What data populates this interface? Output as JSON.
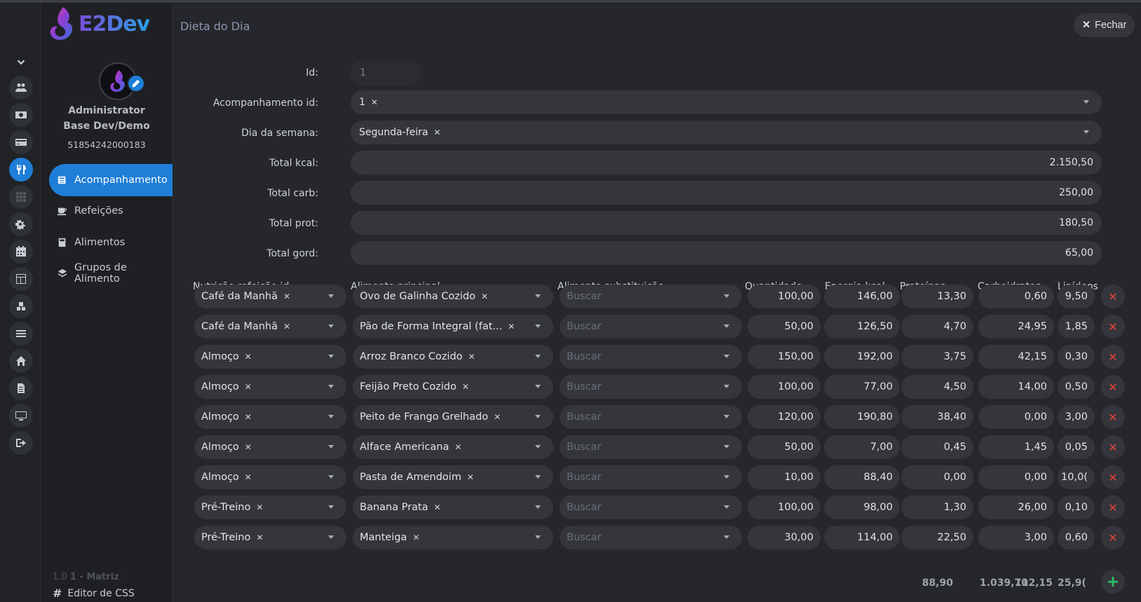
{
  "app": {
    "name": "E2Dev"
  },
  "user": {
    "name": "Administrator",
    "company": "Base Dev/Demo",
    "document": "51854242000183"
  },
  "nav": {
    "items": [
      {
        "label": "Acompanhamento",
        "icon": "newspaper-icon",
        "active": true
      },
      {
        "label": "Refeições",
        "icon": "coffee-cup-icon"
      },
      {
        "label": "Alimentos",
        "icon": "book-icon"
      },
      {
        "label": "Grupos de Alimento",
        "icon": "layers-icon"
      }
    ],
    "version": "1.0",
    "version_extra": "1 - Matriz",
    "css_editor": "Editor de CSS"
  },
  "rail_icons": [
    "users-icon",
    "money-icon",
    "credit-card-icon",
    "utensils-icon",
    "grid-icon",
    "cogs-icon",
    "calendar-icon",
    "layout-icon",
    "boxes-icon",
    "list-icon",
    "home-icon",
    "file-icon",
    "desktop-icon",
    "logout-icon"
  ],
  "page": {
    "title": "Dieta do Dia",
    "close_label": "Fechar"
  },
  "form": {
    "id_label": "Id:",
    "id_value": "1",
    "acomp_label": "Acompanhamento id:",
    "acomp_value": "1",
    "dia_label": "Dia da semana:",
    "dia_value": "Segunda-feira",
    "kcal_label": "Total kcal:",
    "kcal_value": "2.150,50",
    "carb_label": "Total carb:",
    "carb_value": "250,00",
    "prot_label": "Total prot:",
    "prot_value": "180,50",
    "gord_label": "Total gord:",
    "gord_value": "65,00"
  },
  "table": {
    "headers": [
      "Nutrição refeição id",
      "Alimento principal",
      "Alimento substituição",
      "Quantidade",
      "Energia kcal",
      "Proteínas",
      "Carboidratos",
      "Lipídeos"
    ],
    "placeholder": "Buscar",
    "rows": [
      {
        "refeicao": "Café da Manhã",
        "alimento": "Ovo de Galinha Cozido",
        "qtd": "100,00",
        "kcal": "146,00",
        "prot": "13,30",
        "carb": "0,60",
        "lip": "9,50"
      },
      {
        "refeicao": "Café da Manhã",
        "alimento": "Pão de Forma Integral (fat...",
        "qtd": "50,00",
        "kcal": "126,50",
        "prot": "4,70",
        "carb": "24,95",
        "lip": "1,85"
      },
      {
        "refeicao": "Almoço",
        "alimento": "Arroz Branco Cozido",
        "qtd": "150,00",
        "kcal": "192,00",
        "prot": "3,75",
        "carb": "42,15",
        "lip": "0,30"
      },
      {
        "refeicao": "Almoço",
        "alimento": "Feijão Preto Cozido",
        "qtd": "100,00",
        "kcal": "77,00",
        "prot": "4,50",
        "carb": "14,00",
        "lip": "0,50"
      },
      {
        "refeicao": "Almoço",
        "alimento": "Peito de Frango Grelhado",
        "qtd": "120,00",
        "kcal": "190,80",
        "prot": "38,40",
        "carb": "0,00",
        "lip": "3,00"
      },
      {
        "refeicao": "Almoço",
        "alimento": "Alface Americana",
        "qtd": "50,00",
        "kcal": "7,00",
        "prot": "0,45",
        "carb": "1,45",
        "lip": "0,05"
      },
      {
        "refeicao": "Almoço",
        "alimento": "Pasta de Amendoim",
        "qtd": "10,00",
        "kcal": "88,40",
        "prot": "0,00",
        "carb": "0,00",
        "lip": "10,0("
      },
      {
        "refeicao": "Pré-Treino",
        "alimento": "Banana Prata",
        "qtd": "100,00",
        "kcal": "98,00",
        "prot": "1,30",
        "carb": "26,00",
        "lip": "0,10"
      },
      {
        "refeicao": "Pré-Treino",
        "alimento": "Manteiga",
        "qtd": "30,00",
        "kcal": "114,00",
        "prot": "22,50",
        "carb": "3,00",
        "lip": "0,60"
      }
    ],
    "totals": {
      "kcal": "1.039,70",
      "prot": "88,90",
      "carb": "112,15",
      "lip": "25,9("
    }
  }
}
